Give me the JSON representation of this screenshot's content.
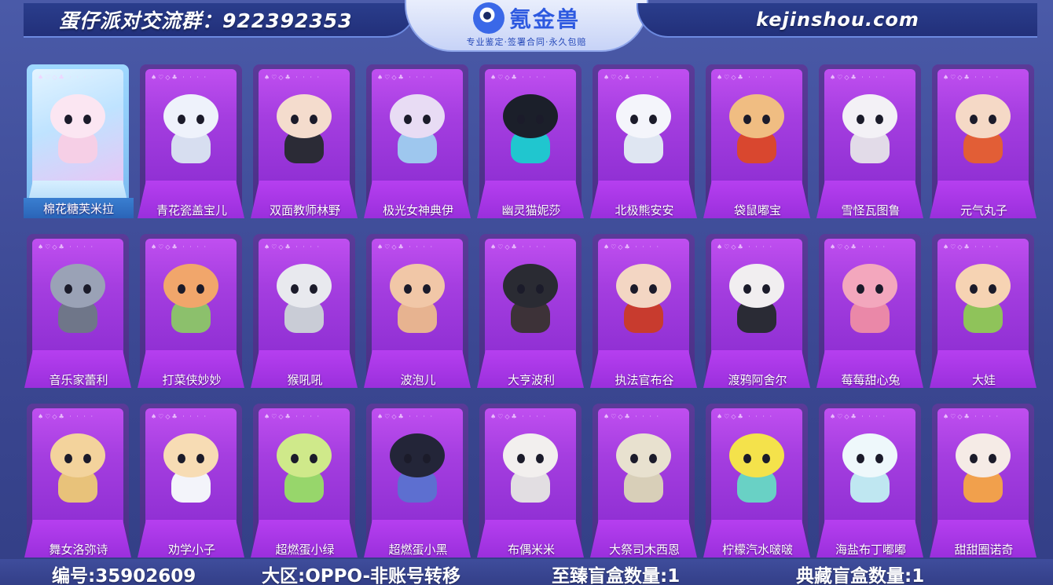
{
  "header": {
    "group_label": "蛋仔派对交流群：922392353",
    "logo_name": "氪金兽",
    "logo_slogan": "专业鉴定·签署合同·永久包赔",
    "site_url": "kejinshou.com"
  },
  "card_suit_marks": "♠♡◇♣ · · · ·",
  "cards": [
    {
      "name": "棉花糖芙米拉",
      "selected": true,
      "head": "#fbe6f2",
      "body": "#f6cfe6"
    },
    {
      "name": "青花瓷盖宝儿",
      "selected": false,
      "head": "#eef2fb",
      "body": "#d7def0"
    },
    {
      "name": "双面教师林野",
      "selected": false,
      "head": "#f4dccd",
      "body": "#2b2b36"
    },
    {
      "name": "极光女神典伊",
      "selected": false,
      "head": "#e8dcf4",
      "body": "#9ec7ee"
    },
    {
      "name": "幽灵猫妮莎",
      "selected": false,
      "head": "#1b1f2a",
      "body": "#20c6cf"
    },
    {
      "name": "北极熊安安",
      "selected": false,
      "head": "#f4f5fb",
      "body": "#dfe6f2"
    },
    {
      "name": "袋鼠嘟宝",
      "selected": false,
      "head": "#f0bd82",
      "body": "#d9472f"
    },
    {
      "name": "雪怪瓦图鲁",
      "selected": false,
      "head": "#f3f1f6",
      "body": "#e2dbe8"
    },
    {
      "name": "元气丸子",
      "selected": false,
      "head": "#f5d9c6",
      "body": "#e25e36"
    },
    {
      "name": "音乐家蕾利",
      "selected": false,
      "head": "#9aa2b6",
      "body": "#6f7689"
    },
    {
      "name": "打菜侠妙妙",
      "selected": false,
      "head": "#f1a66b",
      "body": "#8cc06c"
    },
    {
      "name": "猴吼吼",
      "selected": false,
      "head": "#e8e9ee",
      "body": "#c9ccd6"
    },
    {
      "name": "波泡儿",
      "selected": false,
      "head": "#f1c7a7",
      "body": "#e7b390"
    },
    {
      "name": "大亨波利",
      "selected": false,
      "head": "#2a2b33",
      "body": "#3d3238"
    },
    {
      "name": "执法官布谷",
      "selected": false,
      "head": "#f3d6c3",
      "body": "#c83b2e"
    },
    {
      "name": "渡鸦阿舍尔",
      "selected": false,
      "head": "#f1eef0",
      "body": "#2a2b35"
    },
    {
      "name": "莓莓甜心兔",
      "selected": false,
      "head": "#f3a7bd",
      "body": "#ea88a8"
    },
    {
      "name": "大娃",
      "selected": false,
      "head": "#f6d3b3",
      "body": "#8fc35a"
    },
    {
      "name": "舞女洛弥诗",
      "selected": false,
      "head": "#f3d39c",
      "body": "#e8c27a"
    },
    {
      "name": "劝学小子",
      "selected": false,
      "head": "#f7dcb4",
      "body": "#f3f4fa"
    },
    {
      "name": "超燃蛋小绿",
      "selected": false,
      "head": "#cfe98a",
      "body": "#97d66b"
    },
    {
      "name": "超燃蛋小黑",
      "selected": false,
      "head": "#232538",
      "body": "#5d6fd0"
    },
    {
      "name": "布偶米米",
      "selected": false,
      "head": "#f2efee",
      "body": "#e2dee2"
    },
    {
      "name": "大祭司木西恩",
      "selected": false,
      "head": "#e8e1cf",
      "body": "#d8cfb8"
    },
    {
      "name": "柠檬汽水啵啵",
      "selected": false,
      "head": "#f4e24b",
      "body": "#69d1c5"
    },
    {
      "name": "海盐布丁嘟嘟",
      "selected": false,
      "head": "#eef8fb",
      "body": "#bfe7f1"
    },
    {
      "name": "甜甜圈诺奇",
      "selected": false,
      "head": "#f5ebe6",
      "body": "#f1a04c"
    }
  ],
  "footer": {
    "account_id": "编号:35902609",
    "region": "大区:OPPO-非账号转移",
    "supreme_box": "至臻盲盒数量:1",
    "collection_box": "典藏盲盒数量:1"
  },
  "colors": {
    "accent_blue": "#2d59e0",
    "card_purple": "#a53ee0",
    "background": "#3b4792"
  }
}
